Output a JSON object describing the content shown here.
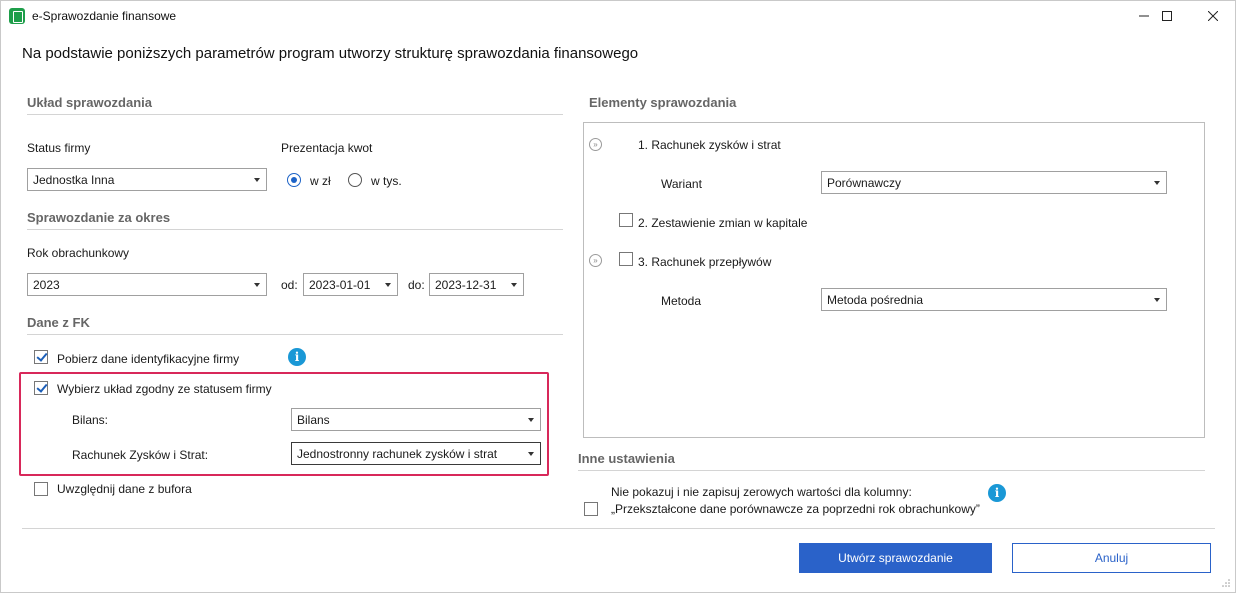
{
  "window": {
    "title": "e-Sprawozdanie finansowe",
    "heading": "Na podstawie poniższych parametrów program utworzy strukturę sprawozdania finansowego"
  },
  "uklad": {
    "section_title": "Układ sprawozdania",
    "status_label": "Status firmy",
    "status_value": "Jednostka Inna",
    "prezentacja_label": "Prezentacja kwot",
    "radio_zl": "w zł",
    "radio_tys": "w tys.",
    "selected_radio": "w zł"
  },
  "okres": {
    "section_title": "Sprawozdanie za okres",
    "rok_label": "Rok obrachunkowy",
    "rok_value": "2023",
    "od_label": "od:",
    "od_value": "2023-01-01",
    "do_label": "do:",
    "do_value": "2023-12-31"
  },
  "fk": {
    "section_title": "Dane z FK",
    "pobierz_label": "Pobierz dane identyfikacyjne firmy",
    "pobierz_checked": true,
    "wybierz_label": "Wybierz układ zgodny ze statusem firmy",
    "wybierz_checked": true,
    "bilans_label": "Bilans:",
    "bilans_value": "Bilans",
    "rzis_label": "Rachunek Zysków i Strat:",
    "rzis_value": "Jednostronny rachunek zysków i strat",
    "bufor_label": "Uwzględnij dane z bufora",
    "bufor_checked": false
  },
  "elementy": {
    "section_title": "Elementy sprawozdania",
    "item1_label": "1. Rachunek zysków i strat",
    "wariant_label": "Wariant",
    "wariant_value": "Porównawczy",
    "item2_label": "2. Zestawienie zmian w kapitale",
    "item2_checked": false,
    "item3_label": "3. Rachunek przepływów",
    "item3_checked": false,
    "metoda_label": "Metoda",
    "metoda_value": "Metoda pośrednia"
  },
  "inne": {
    "section_title": "Inne ustawienia",
    "zero_line1": "Nie pokazuj i nie zapisuj zerowych wartości dla kolumny:",
    "zero_line2": "„Przekształcone dane porównawcze za poprzedni rok obrachunkowy”",
    "zero_checked": false
  },
  "buttons": {
    "create": "Utwórz sprawozdanie",
    "cancel": "Anuluj"
  },
  "icons": {
    "info": "i",
    "collapse": "»"
  },
  "colors": {
    "accent": "#2a62c9",
    "highlight": "#d8285a",
    "info": "#1a98d6"
  }
}
